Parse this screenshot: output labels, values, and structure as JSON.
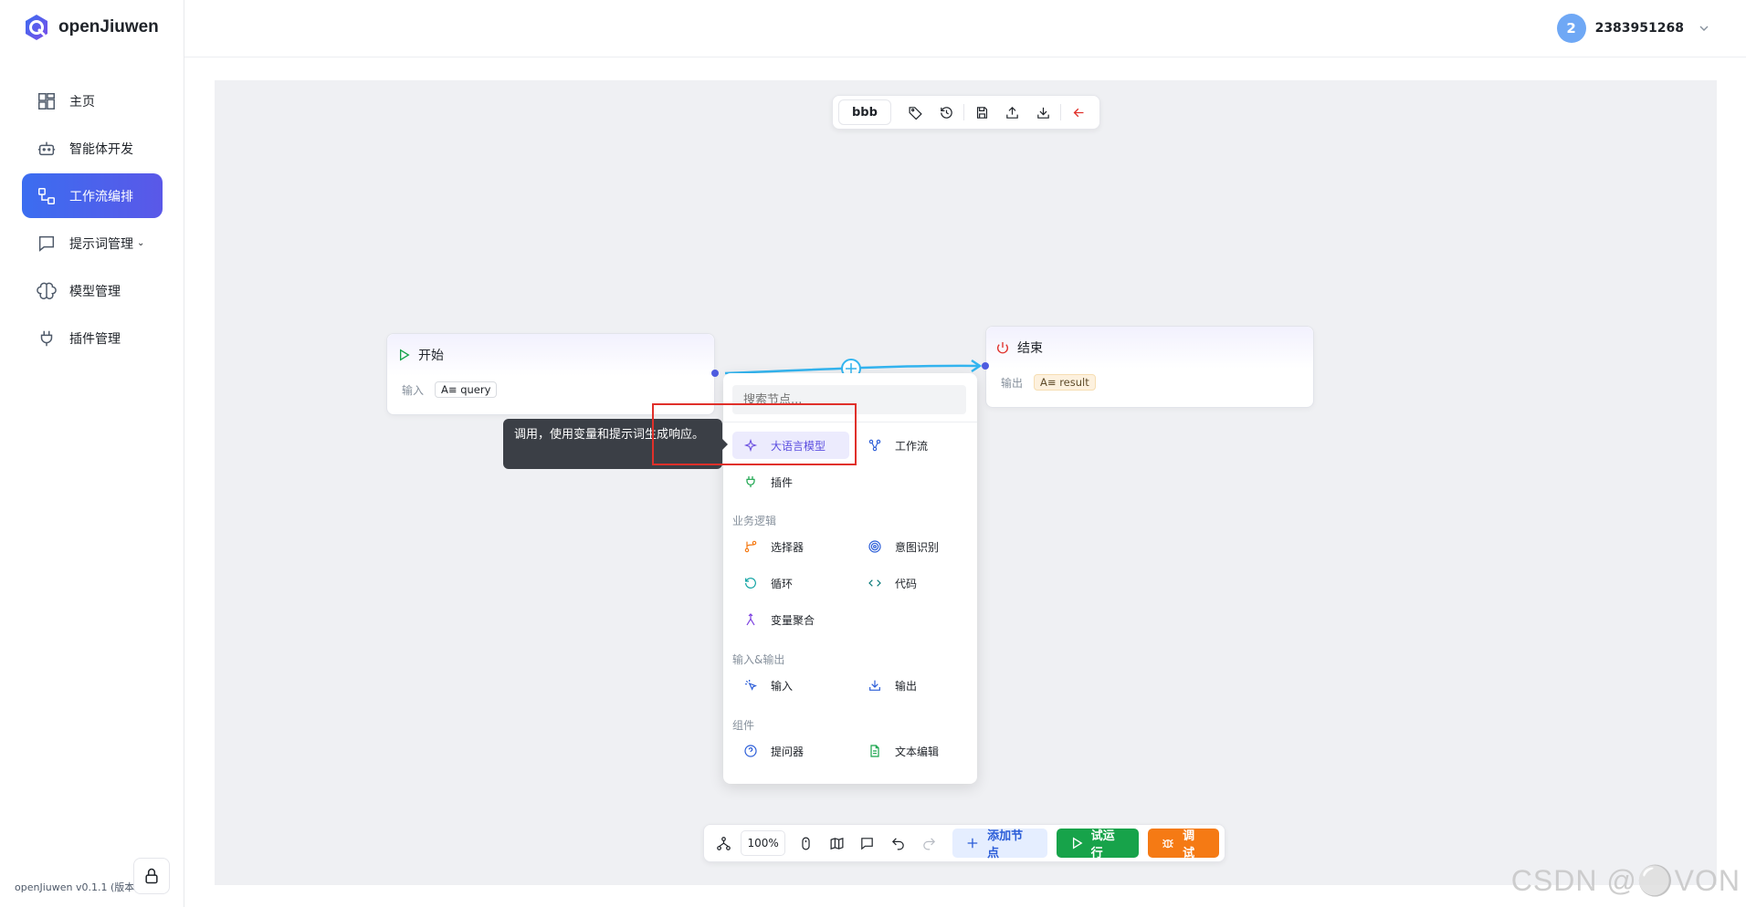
{
  "app": {
    "name": "openJiuwen",
    "version": "openJiuwen v0.1.1 (版本)"
  },
  "sidebar": {
    "items": [
      {
        "label": "主页",
        "icon": "dashboard-icon"
      },
      {
        "label": "智能体开发",
        "icon": "robot-icon"
      },
      {
        "label": "工作流编排",
        "icon": "workflow-icon",
        "active": true
      },
      {
        "label": "提示词管理",
        "icon": "chat-icon",
        "expandable": true
      },
      {
        "label": "模型管理",
        "icon": "brain-icon"
      },
      {
        "label": "插件管理",
        "icon": "plug-icon"
      }
    ],
    "chevron": "⌄"
  },
  "header": {
    "avatar_initial": "2",
    "username": "2383951268"
  },
  "toolbar_top": {
    "flow_name": "bbb"
  },
  "nodes": {
    "start": {
      "title": "开始",
      "body_label": "输入",
      "var": "query",
      "var_prefix": "A≡"
    },
    "end": {
      "title": "结束",
      "body_label": "输出",
      "var": "result",
      "var_prefix": "A≡"
    }
  },
  "popup": {
    "search_placeholder": "搜索节点...",
    "top_items": {
      "llm": "大语言模型",
      "workflow": "工作流",
      "plugin": "插件"
    },
    "sections": {
      "logic": "业务逻辑",
      "io": "输入&输出",
      "component": "组件"
    },
    "logic_items": {
      "selector": "选择器",
      "intent": "意图识别",
      "loop": "循环",
      "code": "代码",
      "aggregate": "变量聚合"
    },
    "io_items": {
      "input": "输入",
      "output": "输出"
    },
    "component_items": {
      "questioner": "提问器",
      "text_edit": "文本编辑"
    }
  },
  "tooltip": {
    "text": "调用，使用变量和提示词生成响应。"
  },
  "toolbar_bottom": {
    "zoom": "100%",
    "add_node": "添加节点",
    "trial_run": "试运行",
    "debug": "调试"
  },
  "watermark": "CSDN @⚪VON",
  "colors": {
    "accent": "#3b6df0",
    "run": "#17a34a",
    "debug": "#f57a14",
    "edge": "#33b5f0",
    "highlight_box": "#e0302a"
  }
}
